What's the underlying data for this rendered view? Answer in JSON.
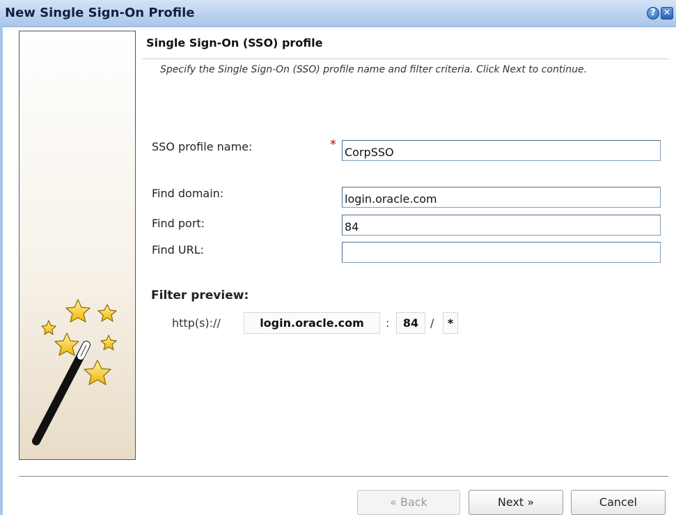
{
  "window": {
    "title": "New Single Sign-On Profile",
    "help_icon": "help-icon",
    "close_icon": "close-icon"
  },
  "section": {
    "title": "Single Sign-On (SSO) profile",
    "instructions": "Specify the Single Sign-On (SSO) profile name and filter criteria. Click Next to continue."
  },
  "form": {
    "sso_name_label": "SSO profile name:",
    "required_marker": "*",
    "sso_name_value": "CorpSSO",
    "domain_label": "Find domain:",
    "domain_value": "login.oracle.com",
    "port_label": "Find port:",
    "port_value": "84",
    "url_label": "Find URL:",
    "url_value": ""
  },
  "preview": {
    "label": "Filter preview:",
    "scheme": "http(s)://",
    "domain": "login.oracle.com",
    "colon": ":",
    "port": "84",
    "slash": "/",
    "path": "*"
  },
  "buttons": {
    "back": "« Back",
    "next": "Next »",
    "cancel": "Cancel"
  },
  "colors": {
    "title_bar": "#b9d1ee",
    "required": "#d00000",
    "star": "#f5c400"
  },
  "side_panel": {
    "icon": "magic-wand-icon"
  }
}
